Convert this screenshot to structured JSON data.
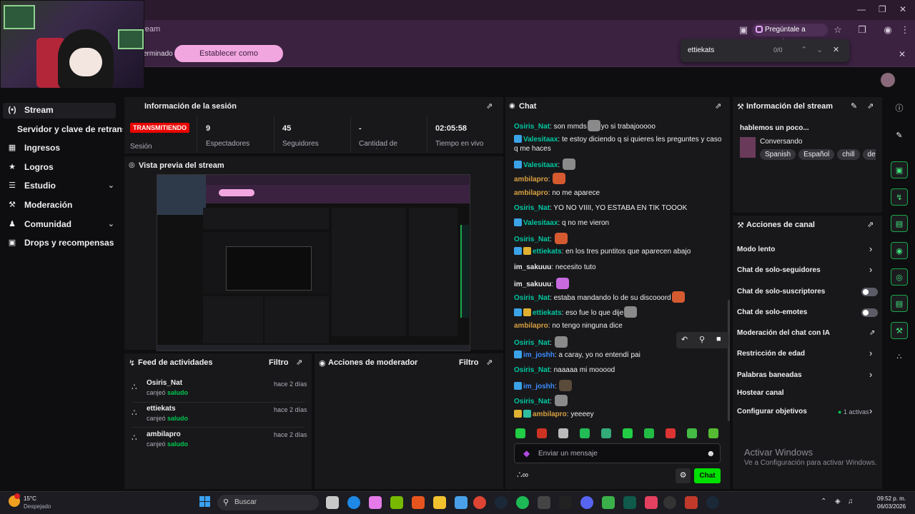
{
  "browser": {
    "url_fragment": "tream",
    "google_button": "Pregúntale a Google",
    "infobar_text": "erminado",
    "default_button": "Establecer como predeterminado",
    "find": {
      "query": "ettiekats",
      "count": "0/0"
    }
  },
  "sidebar": {
    "items": [
      {
        "label": "Stream"
      },
      {
        "label": "Servidor y clave de retransm"
      },
      {
        "label": "Ingresos"
      },
      {
        "label": "Logros"
      },
      {
        "label": "Estudio"
      },
      {
        "label": "Moderación"
      },
      {
        "label": "Comunidad"
      },
      {
        "label": "Drops y recompensas"
      }
    ]
  },
  "session": {
    "title": "Información de la sesión",
    "live_badge": "TRANSMITIENDO",
    "live_label": "Sesión",
    "stats": [
      {
        "value": "9",
        "label": "Espectadores"
      },
      {
        "value": "45",
        "label": "Seguidores"
      },
      {
        "value": "-",
        "label": "Cantidad de suscripciones"
      },
      {
        "value": "02:05:58",
        "label": "Tiempo en vivo"
      }
    ]
  },
  "preview": {
    "title": "Vista previa del stream"
  },
  "activity": {
    "title": "Feed de actividades",
    "filter": "Filtro",
    "items": [
      {
        "name": "Osiris_Nat",
        "action": "canjeó",
        "reward": "saludo",
        "time": "hace 2 días"
      },
      {
        "name": "ettiekats",
        "action": "canjeó",
        "reward": "saludo",
        "time": "hace 2 días"
      },
      {
        "name": "ambilapro",
        "action": "canjeó",
        "reward": "saludo",
        "time": "hace 2 días"
      }
    ]
  },
  "modactions": {
    "title": "Acciones de moderador",
    "filter": "Filtro"
  },
  "chat": {
    "title": "Chat",
    "input_placeholder": "Enviar un mensaje",
    "send_button": "Chat",
    "messages": [
      {
        "user": "Osiris_Nat",
        "color": "#00c8a0",
        "pre": "son mmds",
        "emote": "cat",
        "post": "yo si trabajooooo"
      },
      {
        "user": "Valesitaax",
        "color": "#00c8a0",
        "badges": [
          "blue"
        ],
        "pre": "te estoy diciendo q si quieres les preguntes y caso q me haces"
      },
      {
        "user": "Valesitaax",
        "color": "#00c8a0",
        "badges": [
          "blue"
        ],
        "pre": "",
        "emote": "cat"
      },
      {
        "user": "ambilapro",
        "color": "#d8a040",
        "pre": "",
        "emote": "red"
      },
      {
        "user": "ambilapro",
        "color": "#d8a040",
        "pre": "no me aparece"
      },
      {
        "user": "Osiris_Nat",
        "color": "#00c8a0",
        "pre": "YO NO VIIII, YO ESTABA EN TIK TOOOK"
      },
      {
        "user": "Valesitaax",
        "color": "#00c8a0",
        "badges": [
          "blue"
        ],
        "pre": "q no me vieron"
      },
      {
        "user": "Osiris_Nat",
        "color": "#00c8a0",
        "pre": "",
        "emote": "red"
      },
      {
        "user": "ettiekats",
        "color": "#00c8a0",
        "badges": [
          "blue",
          "gold"
        ],
        "pre": "en los tres puntitos que aparecen abajo"
      },
      {
        "user": "im_sakuuu",
        "color": "#efeff1",
        "pre": "necesito tuto"
      },
      {
        "user": "im_sakuuu",
        "color": "#efeff1",
        "pre": "",
        "emote": "pink"
      },
      {
        "user": "Osiris_Nat",
        "color": "#00c8a0",
        "pre": "estaba mandando lo de su discooord",
        "emote": "red"
      },
      {
        "user": "ettiekats",
        "color": "#00c8a0",
        "badges": [
          "blue",
          "gold"
        ],
        "pre": "eso fue lo que dije",
        "emote": "cat"
      },
      {
        "user": "ambilapro",
        "color": "#d8a040",
        "pre": "no tengo ninguna dice"
      },
      {
        "user": "Osiris_Nat",
        "color": "#00c8a0",
        "pre": "",
        "emote": "cat"
      },
      {
        "user": "im_joshh",
        "color": "#3b8cff",
        "badges": [
          "blue"
        ],
        "pre": "a caray, yo no entendí pai"
      },
      {
        "user": "Osiris_Nat",
        "color": "#00c8a0",
        "pre": "naaaaa mi mooood"
      },
      {
        "user": "im_joshh",
        "color": "#3b8cff",
        "badges": [
          "blue"
        ],
        "pre": "",
        "emote": "dark"
      },
      {
        "user": "Osiris_Nat",
        "color": "#00c8a0",
        "pre": "",
        "emote": "cat"
      },
      {
        "user": "ambilapro",
        "color": "#d8a040",
        "badges": [
          "gold",
          "green"
        ],
        "pre": "yeeeey"
      }
    ]
  },
  "stream_info": {
    "title": "Información del stream",
    "stream_title": "hablemos un poco...",
    "category": "Conversando",
    "tags": [
      "Spanish",
      "Español",
      "chill",
      "deto"
    ]
  },
  "channel_actions": {
    "title": "Acciones de canal",
    "items": [
      {
        "label": "Modo lento",
        "control": "chevron"
      },
      {
        "label": "Chat de solo-seguidores",
        "control": "chevron"
      },
      {
        "label": "Chat de solo-suscriptores",
        "control": "toggle"
      },
      {
        "label": "Chat de solo-emotes",
        "control": "toggle"
      },
      {
        "label": "Moderación del chat con IA",
        "control": "external"
      },
      {
        "label": "Restricción de edad",
        "control": "chevron"
      },
      {
        "label": "Palabras baneadas",
        "control": "chevron"
      },
      {
        "label": "Hostear canal",
        "control": "none"
      },
      {
        "label": "Configurar objetivos",
        "control": "chevron",
        "status": "1 activas"
      }
    ]
  },
  "watermark": {
    "line1": "Activar Windows",
    "line2": "Ve a Configuración para activar Windows."
  },
  "taskbar": {
    "weather_temp": "15°C",
    "weather_desc": "Despejado",
    "search_placeholder": "Buscar",
    "time": "09:52 p. m.",
    "date": "06/03/2026"
  },
  "colors": {
    "accent_green": "#00e000",
    "live_red": "#eb0400",
    "rail_green": "#1aa84a",
    "pink_button": "#f2a6e0"
  }
}
